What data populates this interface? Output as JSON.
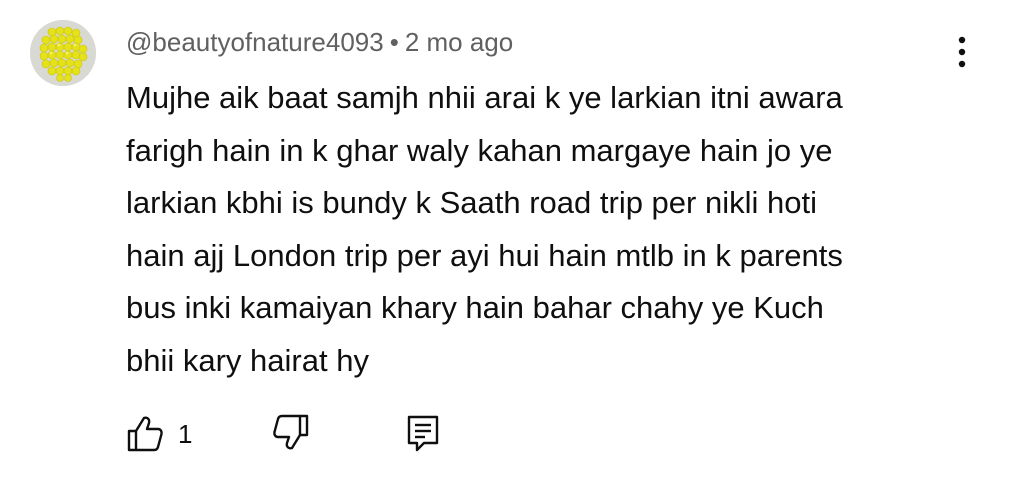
{
  "comment": {
    "author": "@beautyofnature4093",
    "separator": "•",
    "timestamp": "2 mo ago",
    "text_lines": [
      "Mujhe aik baat samjh nhii arai k ye larkian itni awara",
      "farigh hain in k ghar waly kahan margaye hain jo ye",
      "larkian kbhi is bundy k Saath road trip per nikli hoti",
      "hain ajj London trip per ayi hui hain mtlb in k parents",
      "bus inki kamaiyan khary hain bahar chahy ye Kuch",
      "bhii kary hairat hy"
    ],
    "like_count": "1",
    "avatar_color": "#e6e21a"
  },
  "icons": {
    "avatar": "yellow-beads-avatar",
    "menu": "more-vertical-icon",
    "like": "thumbs-up-icon",
    "dislike": "thumbs-down-icon",
    "reply": "comment-reply-icon"
  },
  "colors": {
    "meta_text": "#606060",
    "body_text": "#0f0f0f",
    "background": "#ffffff"
  }
}
